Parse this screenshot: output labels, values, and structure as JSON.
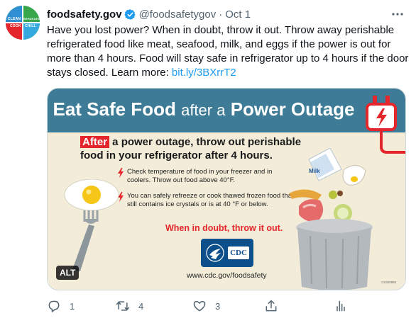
{
  "tweet": {
    "author_name": "foodsafety.gov",
    "handle": "@foodsafetygov",
    "separator": "·",
    "time": "Oct 1",
    "avatar_labels": [
      "CLEAN",
      "SEPARATE",
      "COOK",
      "CHILL"
    ],
    "text_main": "Have you lost power? When in doubt, throw it out. Throw away perishable refrigerated food like meat, seafood, milk, and eggs if the power is out for more than 4 hours. Food will stay safe in refrigerator up to 4 hours if the door stays closed. Learn more: ",
    "link_text": "bit.ly/3BXrrT2"
  },
  "card": {
    "title_part1": "Eat Safe Food",
    "title_part2": "after a",
    "title_part3": "Power Outage",
    "headline_highlight": "After",
    "headline_rest": " a power outage, throw out perishable food in your refrigerator after 4 hours.",
    "bullet1": "Check temperature of food in your freezer and in coolers. Throw out food above 40°F.",
    "bullet2": "You can safely refreeze or cook thawed frozen food that still contains ice crystals or is at 40 °F or below.",
    "warning": "When in doubt, throw it out.",
    "logo_text": "CDC",
    "url": "www.cdc.gov/foodsafety",
    "code": "CS320992",
    "milk_label": "Milk",
    "alt_badge": "ALT"
  },
  "actions": {
    "replies": "1",
    "retweets": "4",
    "likes": "3"
  },
  "colors": {
    "link": "#1d9bf0",
    "muted": "#536471",
    "banner": "#3d7b96",
    "accent_red": "#e4262c",
    "card_bg": "#f2ecd8",
    "cdc_blue": "#0d4f8b"
  },
  "icons": [
    "verified-badge-icon",
    "more-options-icon",
    "reply-icon",
    "retweet-icon",
    "like-icon",
    "share-icon",
    "analytics-icon",
    "lightning-bolt-icon",
    "power-plug-icon",
    "fork-egg-icon",
    "trash-can-icon",
    "hhs-eagle-icon"
  ]
}
